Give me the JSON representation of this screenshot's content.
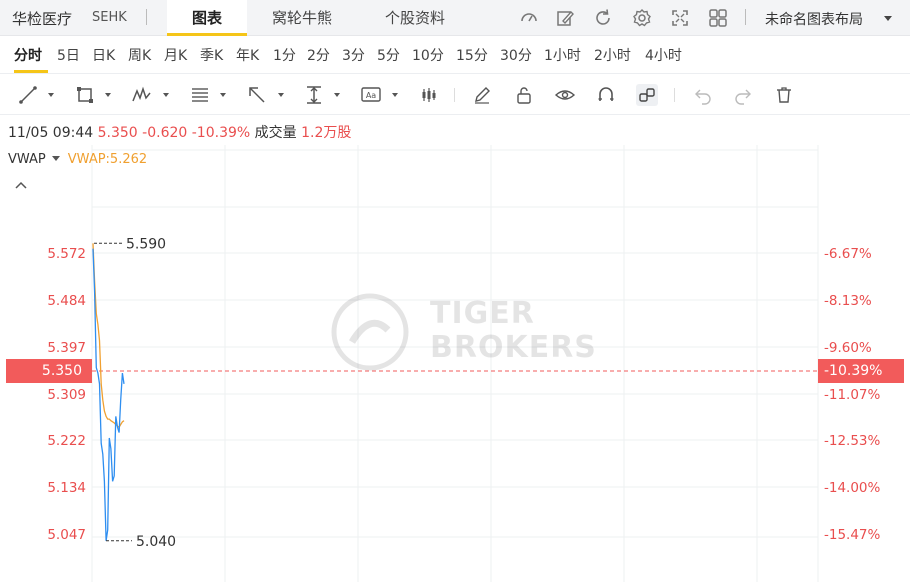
{
  "header": {
    "stock_name": "华检医疗",
    "market": "SEHK",
    "tabs": [
      "图表",
      "窝轮牛熊",
      "个股资料"
    ],
    "active_tab": 0,
    "layout_label": "未命名图表布局",
    "icons": [
      "refresh-gauge-icon",
      "edit-icon",
      "reload-icon",
      "settings-icon",
      "fullscreen-icon",
      "grid-layout-icon"
    ]
  },
  "periods": {
    "items": [
      "分时",
      "5日",
      "日K",
      "周K",
      "月K",
      "季K",
      "年K",
      "1分",
      "2分",
      "3分",
      "5分",
      "10分",
      "15分",
      "30分",
      "1小时",
      "2小时",
      "4小时"
    ],
    "active": 0
  },
  "toolbar": {
    "icons": [
      "line-tool-icon",
      "rectangle-tool-icon",
      "pattern-tool-icon",
      "fib-tool-icon",
      "arrow-tool-icon",
      "measure-tool-icon",
      "text-tool-icon",
      "candlestick-icon",
      "pencil-icon",
      "lock-icon",
      "eye-icon",
      "magnet-icon",
      "link-icon",
      "undo-icon",
      "redo-icon",
      "trash-icon"
    ]
  },
  "info": {
    "datetime": "11/05 09:44",
    "price": "5.350",
    "change": "-0.620",
    "change_pct": "-10.39%",
    "volume_label": "成交量",
    "volume": "1.2万股"
  },
  "vwap": {
    "name": "VWAP",
    "value": "VWAP:5.262"
  },
  "chart_data": {
    "type": "line",
    "y_left_ticks": [
      "5.572",
      "5.484",
      "5.397",
      "5.309",
      "5.222",
      "5.134",
      "5.047"
    ],
    "y_right_ticks": [
      "-6.67%",
      "-8.13%",
      "-9.60%",
      "-11.07%",
      "-12.53%",
      "-14.00%",
      "-15.47%"
    ],
    "ylim": [
      5.0,
      5.64
    ],
    "current_price": "5.350",
    "current_pct": "-10.39%",
    "high_label": "5.590",
    "low_label": "5.040",
    "high": 5.59,
    "low": 5.04,
    "series": [
      {
        "name": "price",
        "color": "#2e8ef0",
        "values": [
          5.58,
          5.5,
          5.36,
          5.35,
          5.33,
          5.22,
          5.2,
          5.15,
          5.04,
          5.06,
          5.23,
          5.21,
          5.15,
          5.16,
          5.27,
          5.25,
          5.24,
          5.3,
          5.35,
          5.33
        ]
      },
      {
        "name": "VWAP",
        "color": "#f0a030",
        "values": [
          5.59,
          5.52,
          5.46,
          5.44,
          5.41,
          5.33,
          5.3,
          5.28,
          5.27,
          5.265,
          5.265,
          5.262,
          5.26,
          5.258,
          5.255,
          5.252,
          5.25,
          5.255,
          5.26,
          5.262
        ]
      }
    ],
    "grid": true
  }
}
